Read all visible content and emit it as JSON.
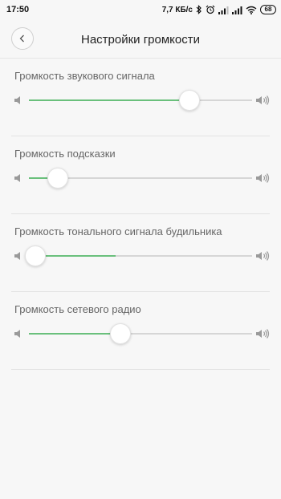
{
  "status_bar": {
    "time": "17:50",
    "network_speed": "7,7 КБ/с",
    "battery_level": "68",
    "icons": [
      "bluetooth-icon",
      "alarm-icon",
      "signal-icon",
      "signal-icon",
      "wifi-icon",
      "battery-icon"
    ]
  },
  "header": {
    "title": "Настройки громкости",
    "back_icon": "chevron-left-icon"
  },
  "accent_color": "#6ac07c",
  "settings": [
    {
      "label": "Громкость звукового сигнала",
      "level": 0.72,
      "fill": 0.72
    },
    {
      "label": "Громкость подсказки",
      "level": 0.13,
      "fill": 0.13
    },
    {
      "label": "Громкость тонального сигнала будильника",
      "level": 0.03,
      "fill": 0.39
    },
    {
      "label": "Громкость сетевого радио",
      "level": 0.41,
      "fill": 0.41
    }
  ]
}
